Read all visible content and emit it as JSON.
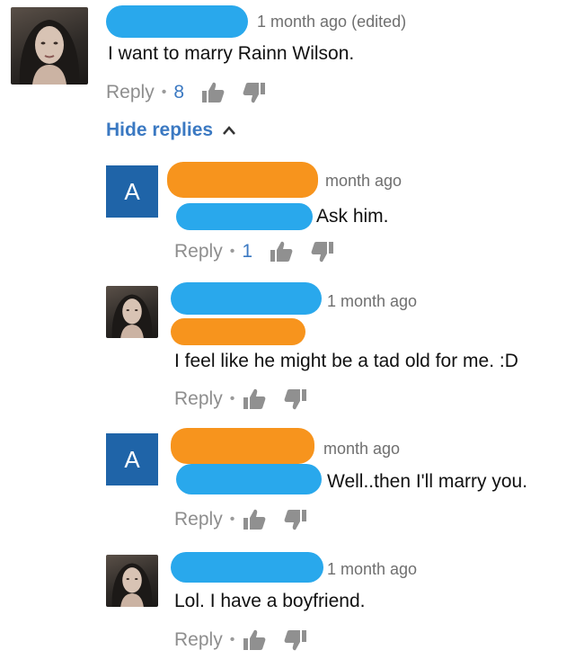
{
  "colors": {
    "redact_blue": "#29a8ec",
    "redact_orange": "#f7941d",
    "link_blue": "#3b79c2",
    "letter_avatar_bg": "#1f64a8"
  },
  "icons": [
    "thumbs-up-icon",
    "thumbs-down-icon",
    "chevron-up-icon"
  ],
  "top_comment": {
    "timestamp": "1 month ago (edited)",
    "text": "I want to marry Rainn Wilson.",
    "reply_label": "Reply",
    "likes": "8",
    "hide_replies_label": "Hide replies"
  },
  "replies": [
    {
      "avatar_letter": "A",
      "timestamp": "month ago",
      "text": "Ask him.",
      "reply_label": "Reply",
      "likes": "1"
    },
    {
      "timestamp": "1 month ago",
      "text": "I feel like he might be a tad old for me. :D",
      "reply_label": "Reply"
    },
    {
      "avatar_letter": "A",
      "timestamp": "month ago",
      "text": "Well..then I'll marry you.",
      "reply_label": "Reply"
    },
    {
      "timestamp": "1 month ago",
      "text": "Lol. I have a boyfriend.",
      "reply_label": "Reply"
    }
  ]
}
